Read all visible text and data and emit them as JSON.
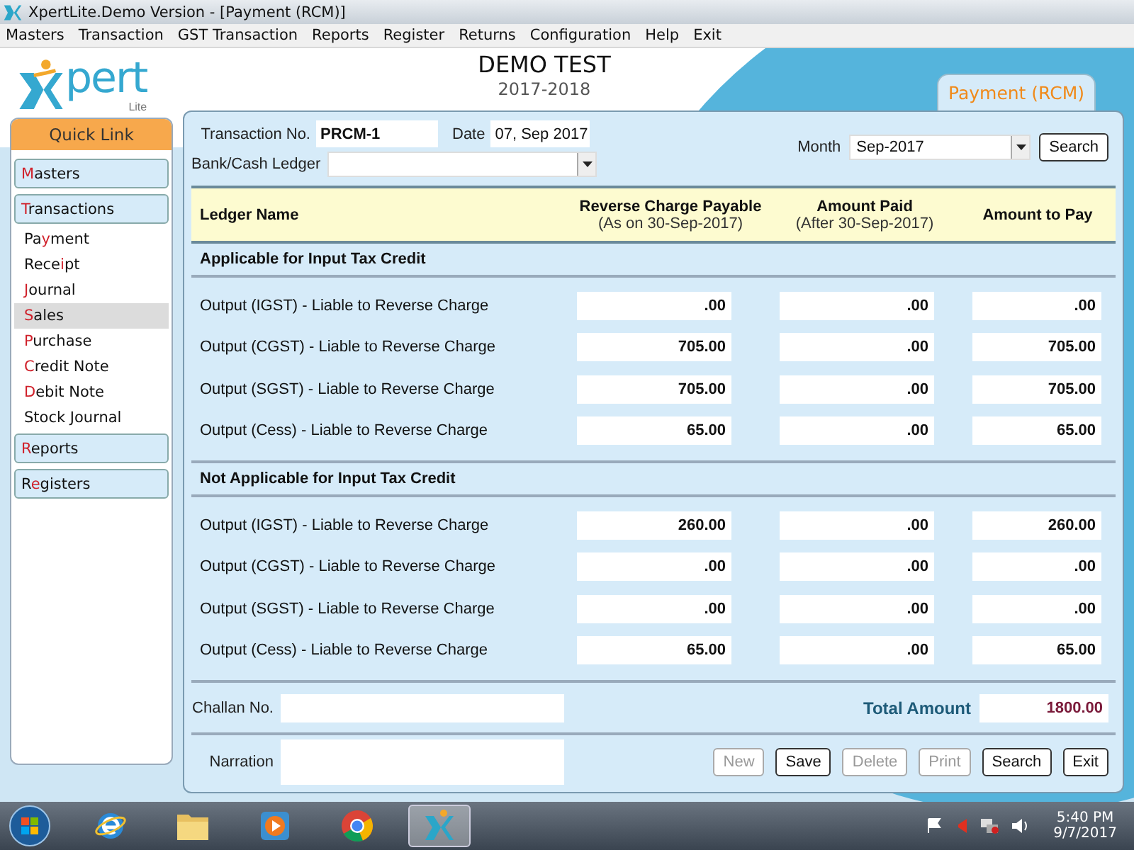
{
  "window": {
    "title": "XpertLite.Demo Version - [Payment (RCM)]"
  },
  "menu": [
    "Masters",
    "Transaction",
    "GST Transaction",
    "Reports",
    "Register",
    "Returns",
    "Configuration",
    "Help",
    "Exit"
  ],
  "logo": {
    "text": "pert",
    "subtext": "Lite"
  },
  "company": {
    "name": "DEMO TEST",
    "year": "2017-2018"
  },
  "page_tab": {
    "label": "Payment (RCM)"
  },
  "sidebar": {
    "title": "Quick Link",
    "items": [
      {
        "key": "M",
        "post": "asters"
      },
      {
        "key": "T",
        "post": "ransactions",
        "children": [
          {
            "pre": "Pa",
            "key": "y",
            "post": "ment",
            "selected": false
          },
          {
            "pre": "Rece",
            "key": "i",
            "post": "pt",
            "selected": false
          },
          {
            "key": "J",
            "post": "ournal",
            "selected": false
          },
          {
            "key": "S",
            "post": "ales",
            "selected": true
          },
          {
            "key": "P",
            "post": "urchase",
            "selected": false
          },
          {
            "key": "C",
            "post": "redit Note",
            "selected": false
          },
          {
            "key": "D",
            "post": "ebit Note",
            "selected": false
          },
          {
            "pre": "Stock Journal",
            "selected": false
          }
        ]
      },
      {
        "key": "R",
        "post": "eports"
      },
      {
        "pre": "R",
        "key": "e",
        "post": "gisters"
      }
    ]
  },
  "form": {
    "transaction_no": {
      "label": "Transaction No.",
      "value": "PRCM-1"
    },
    "date": {
      "label": "Date",
      "value": "07, Sep 2017"
    },
    "bank_ledger": {
      "label": "Bank/Cash Ledger"
    },
    "month": {
      "label": "Month",
      "value": "Sep-2017"
    },
    "search_button": "Search"
  },
  "table": {
    "columns": [
      {
        "title": "Ledger Name"
      },
      {
        "title": "Reverse Charge Payable",
        "subtitle": "(As on 30-Sep-2017)"
      },
      {
        "title": "Amount Paid",
        "subtitle": "(After 30-Sep-2017)"
      },
      {
        "title": "Amount to Pay"
      }
    ],
    "sections": [
      {
        "title": "Applicable for Input Tax Credit",
        "rows": [
          {
            "ledger": "Output (IGST) - Liable to Reverse Charge",
            "payable": ".00",
            "paid": ".00",
            "to_pay": ".00"
          },
          {
            "ledger": "Output (CGST) - Liable to Reverse Charge",
            "payable": "705.00",
            "paid": ".00",
            "to_pay": "705.00"
          },
          {
            "ledger": "Output (SGST) - Liable to Reverse Charge",
            "payable": "705.00",
            "paid": ".00",
            "to_pay": "705.00"
          },
          {
            "ledger": "Output (Cess) - Liable to Reverse Charge",
            "payable": "65.00",
            "paid": ".00",
            "to_pay": "65.00"
          }
        ]
      },
      {
        "title": "Not Applicable for Input Tax Credit",
        "rows": [
          {
            "ledger": "Output (IGST) - Liable to Reverse Charge",
            "payable": "260.00",
            "paid": ".00",
            "to_pay": "260.00"
          },
          {
            "ledger": "Output (CGST) - Liable to Reverse Charge",
            "payable": ".00",
            "paid": ".00",
            "to_pay": ".00"
          },
          {
            "ledger": "Output (SGST) - Liable to Reverse Charge",
            "payable": ".00",
            "paid": ".00",
            "to_pay": ".00"
          },
          {
            "ledger": "Output (Cess) - Liable to Reverse Charge",
            "payable": "65.00",
            "paid": ".00",
            "to_pay": "65.00"
          }
        ]
      }
    ]
  },
  "footer": {
    "challan": {
      "label": "Challan No."
    },
    "total": {
      "label": "Total Amount",
      "value": "1800.00"
    },
    "narration": {
      "label": "Narration"
    },
    "buttons": [
      {
        "label": "New",
        "disabled": true
      },
      {
        "label": "Save",
        "disabled": false
      },
      {
        "label": "Delete",
        "disabled": true
      },
      {
        "label": "Print",
        "disabled": true
      },
      {
        "label": "Search",
        "disabled": false
      },
      {
        "label": "Exit",
        "disabled": false
      }
    ]
  },
  "taskbar": {
    "apps": [
      {
        "kind": "browser",
        "selected": false
      },
      {
        "kind": "folder",
        "selected": false
      },
      {
        "kind": "media",
        "selected": false
      },
      {
        "kind": "chrome",
        "selected": false
      },
      {
        "kind": "xpert",
        "selected": true
      }
    ],
    "time": "5:40 PM",
    "date": "9/7/2017"
  }
}
